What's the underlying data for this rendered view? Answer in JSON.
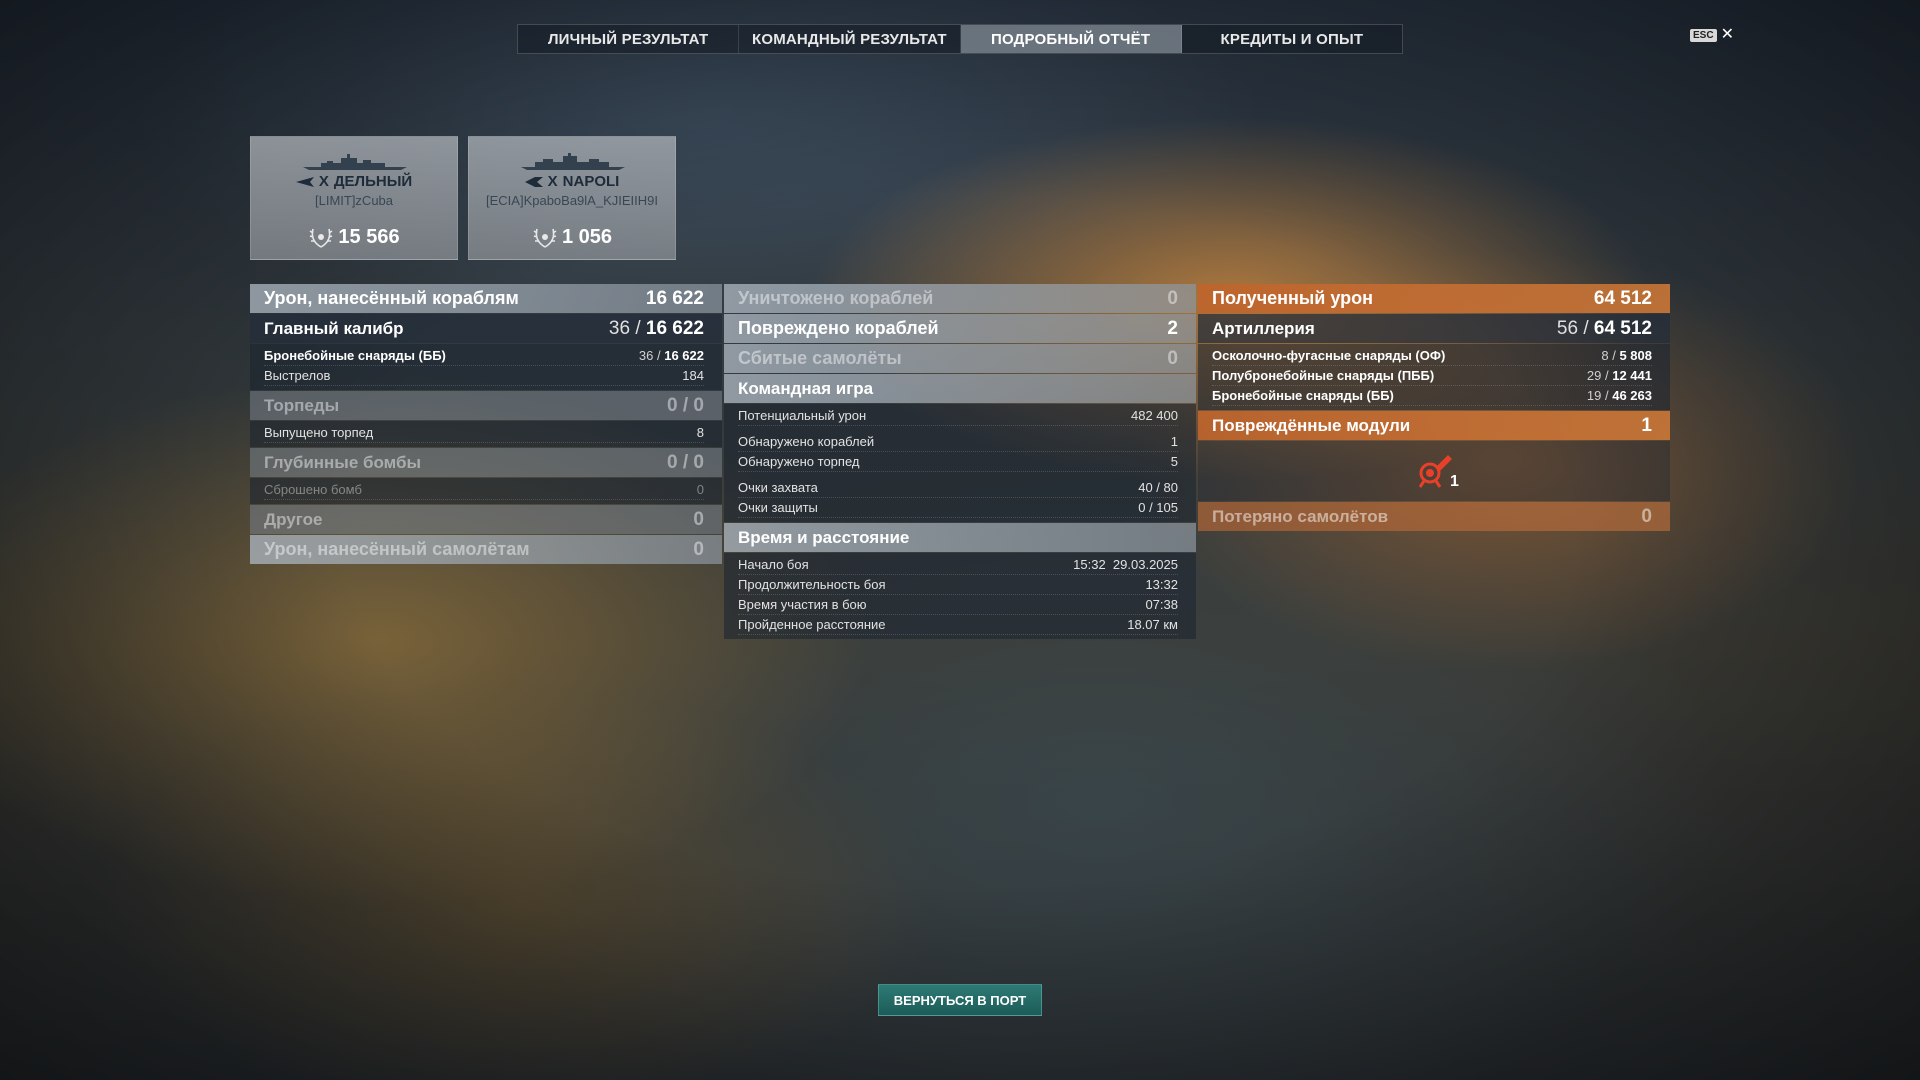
{
  "tabs": [
    {
      "label": "ЛИЧНЫЙ РЕЗУЛЬТАТ"
    },
    {
      "label": "КОМАНДНЫЙ РЕЗУЛЬТАТ"
    },
    {
      "label": "ПОДРОБНЫЙ ОТЧЁТ",
      "active": true
    },
    {
      "label": "КРЕДИТЫ И ОПЫТ"
    }
  ],
  "close": {
    "key_label": "ESC",
    "icon": "close-icon",
    "symbol": "✕"
  },
  "ships": [
    {
      "tier": "X",
      "name": "ДЕЛЬНЫЙ",
      "player": "[LIMIT]zCuba",
      "score": "15 566",
      "class_icon": "destroyer-icon"
    },
    {
      "tier": "X",
      "name": "NAPOLI",
      "player": "[ECIA]KpaboBa9lA_KJIEIIH9I",
      "score": "1 056",
      "class_icon": "cruiser-icon"
    }
  ],
  "damage_dealt": {
    "title": "Урон, нанесённый кораблям",
    "total": "16 622",
    "main_caliber": {
      "label": "Главный калибр",
      "hits": "36",
      "sep": "/",
      "damage": "16 622"
    },
    "ap_shells": {
      "label": "Бронебойные снаряды (ББ)",
      "hits": "36",
      "sep": "/",
      "damage": "16 622"
    },
    "shots": {
      "label": "Выстрелов",
      "value": "184"
    },
    "torpedoes": {
      "label": "Торпеды",
      "value": "0 / 0"
    },
    "torpedoes_launched": {
      "label": "Выпущено торпед",
      "value": "8"
    },
    "depth_charges": {
      "label": "Глубинные бомбы",
      "value": "0 / 0"
    },
    "bombs_dropped": {
      "label": "Сброшено бомб",
      "value": "0"
    },
    "other": {
      "label": "Другое",
      "value": "0"
    },
    "aircraft_damage": {
      "label": "Урон, нанесённый самолётам",
      "value": "0"
    }
  },
  "results": {
    "ships_destroyed": {
      "label": "Уничтожено кораблей",
      "value": "0"
    },
    "ships_damaged": {
      "label": "Повреждено кораблей",
      "value": "2"
    },
    "planes_shot": {
      "label": "Сбитые самолёты",
      "value": "0"
    }
  },
  "team_play": {
    "title": "Командная игра",
    "potential_damage": {
      "label": "Потенциальный урон",
      "value": "482 400"
    },
    "ships_spotted": {
      "label": "Обнаружено кораблей",
      "value": "1"
    },
    "torpedoes_spotted": {
      "label": "Обнаружено торпед",
      "value": "5"
    },
    "capture_points": {
      "label": "Очки захвата",
      "value": "40 / 80"
    },
    "defense_points": {
      "label": "Очки защиты",
      "value": "0 / 105"
    }
  },
  "time_distance": {
    "title": "Время и расстояние",
    "battle_start": {
      "label": "Начало боя",
      "value": "15:32  29.03.2025"
    },
    "battle_duration": {
      "label": "Продолжительность боя",
      "value": "13:32"
    },
    "participation_time": {
      "label": "Время участия в бою",
      "value": "07:38"
    },
    "distance": {
      "label": "Пройденное расстояние",
      "value": "18.07 км"
    }
  },
  "damage_received": {
    "title": "Полученный урон",
    "total": "64 512",
    "artillery": {
      "label": "Артиллерия",
      "hits": "56",
      "sep": "/",
      "damage": "64 512"
    },
    "he_shells": {
      "label": "Осколочно-фугасные снаряды (ОФ)",
      "hits": "8",
      "sep": "/",
      "damage": "5 808"
    },
    "sap_shells": {
      "label": "Полубронебойные снаряды (ПББ)",
      "hits": "29",
      "sep": "/",
      "damage": "12 441"
    },
    "ap_shells": {
      "label": "Бронебойные снаряды (ББ)",
      "hits": "19",
      "sep": "/",
      "damage": "46 263"
    }
  },
  "damaged_modules": {
    "title": "Повреждённые модули",
    "count": "1",
    "items": [
      {
        "icon": "torpedo-tubes-icon",
        "count": "1",
        "color": "#e8402a"
      }
    ]
  },
  "planes_lost": {
    "label": "Потеряно самолётов",
    "value": "0"
  },
  "return_button": {
    "label": "ВЕРНУТЬСЯ В ПОРТ"
  }
}
